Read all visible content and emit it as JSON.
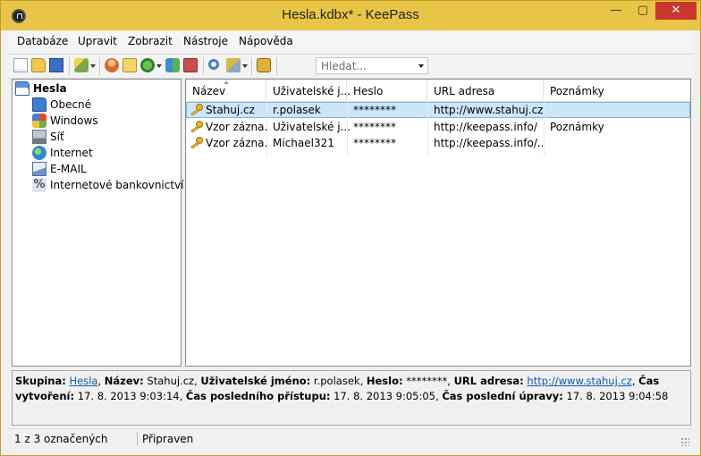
{
  "window": {
    "title": "Hesla.kdbx* - KeePass"
  },
  "window_controls": {
    "minimize": "—",
    "maximize": "▢",
    "close": "✕"
  },
  "menu": [
    "Databáze",
    "Upravit",
    "Zobrazit",
    "Nástroje",
    "Nápověda"
  ],
  "toolbar": {
    "search_placeholder": "Hledat..."
  },
  "tree": {
    "root": "Hesla",
    "items": [
      "Obecné",
      "Windows",
      "Síť",
      "Internet",
      "E-MAIL",
      "Internetové bankovnictví"
    ]
  },
  "entries": {
    "columns": [
      "Název",
      "Uživatelské j...",
      "Heslo",
      "URL adresa",
      "Poznámky"
    ],
    "rows": [
      [
        "Stahuj.cz",
        "r.polasek",
        "********",
        "http://www.stahuj.cz",
        ""
      ],
      [
        "Vzor zázna...",
        "Uživatelské j...",
        "********",
        "http://keepass.info/",
        "Poznámky"
      ],
      [
        "Vzor zázna...",
        "Michael321",
        "********",
        "http://keepass.info/...",
        ""
      ]
    ]
  },
  "details": {
    "group_label": "Skupina:",
    "group_value": "Hesla",
    "title_label": "Název:",
    "title_value": "Stahuj.cz",
    "user_label": "Uživatelské jméno:",
    "user_value": "r.polasek",
    "password_label": "Heslo:",
    "password_value": "********",
    "url_label": "URL adresa:",
    "url_value": "http://www.stahuj.cz",
    "created_label": "Čas vytvoření:",
    "created_value": "17. 8. 2013 9:03:14",
    "accessed_label": "Čas posledního přístupu:",
    "accessed_value": "17. 8. 2013 9:05:05",
    "modified_label": "Čas poslední úpravy:",
    "modified_value": "17. 8. 2013 9:04:58"
  },
  "status": {
    "selection": "1 z 3 označených",
    "state": "Připraven"
  },
  "colors": {
    "titlebar": "#e8c547",
    "selection": "#cce6f8",
    "link": "#0b5cad"
  }
}
